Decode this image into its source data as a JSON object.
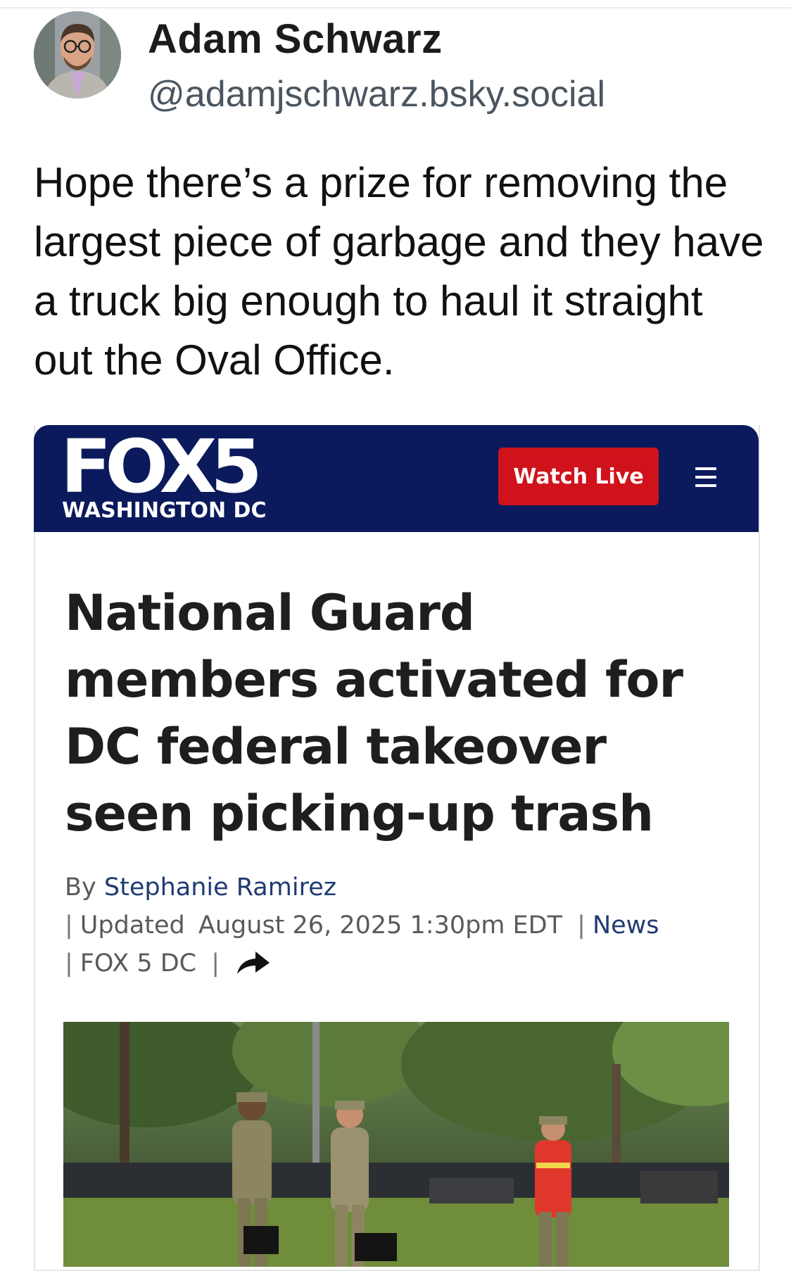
{
  "post": {
    "author_name": "Adam Schwarz",
    "author_handle": "@adamjschwarz.bsky.social",
    "text": "Hope there’s a prize for removing the largest piece of garbage and they have a truck big enough to haul it straight out the Oval Office."
  },
  "embed": {
    "logo_text": "FOX5",
    "logo_subtitle": "WASHINGTON DC",
    "watch_live_label": "Watch Live",
    "header_color": "#0b1a5c",
    "watch_live_color": "#d0121b",
    "headline": "National Guard members activated for DC federal takeover seen picking-up trash",
    "byline": {
      "by_prefix": "By",
      "author": "Stephanie Ramirez",
      "updated_label": "Updated",
      "date": "August 26, 2025 1:30pm EDT",
      "category": "News",
      "source": "FOX 5 DC"
    },
    "share_icon": "share-arrow-icon",
    "menu_icon": "hamburger-menu-icon"
  }
}
